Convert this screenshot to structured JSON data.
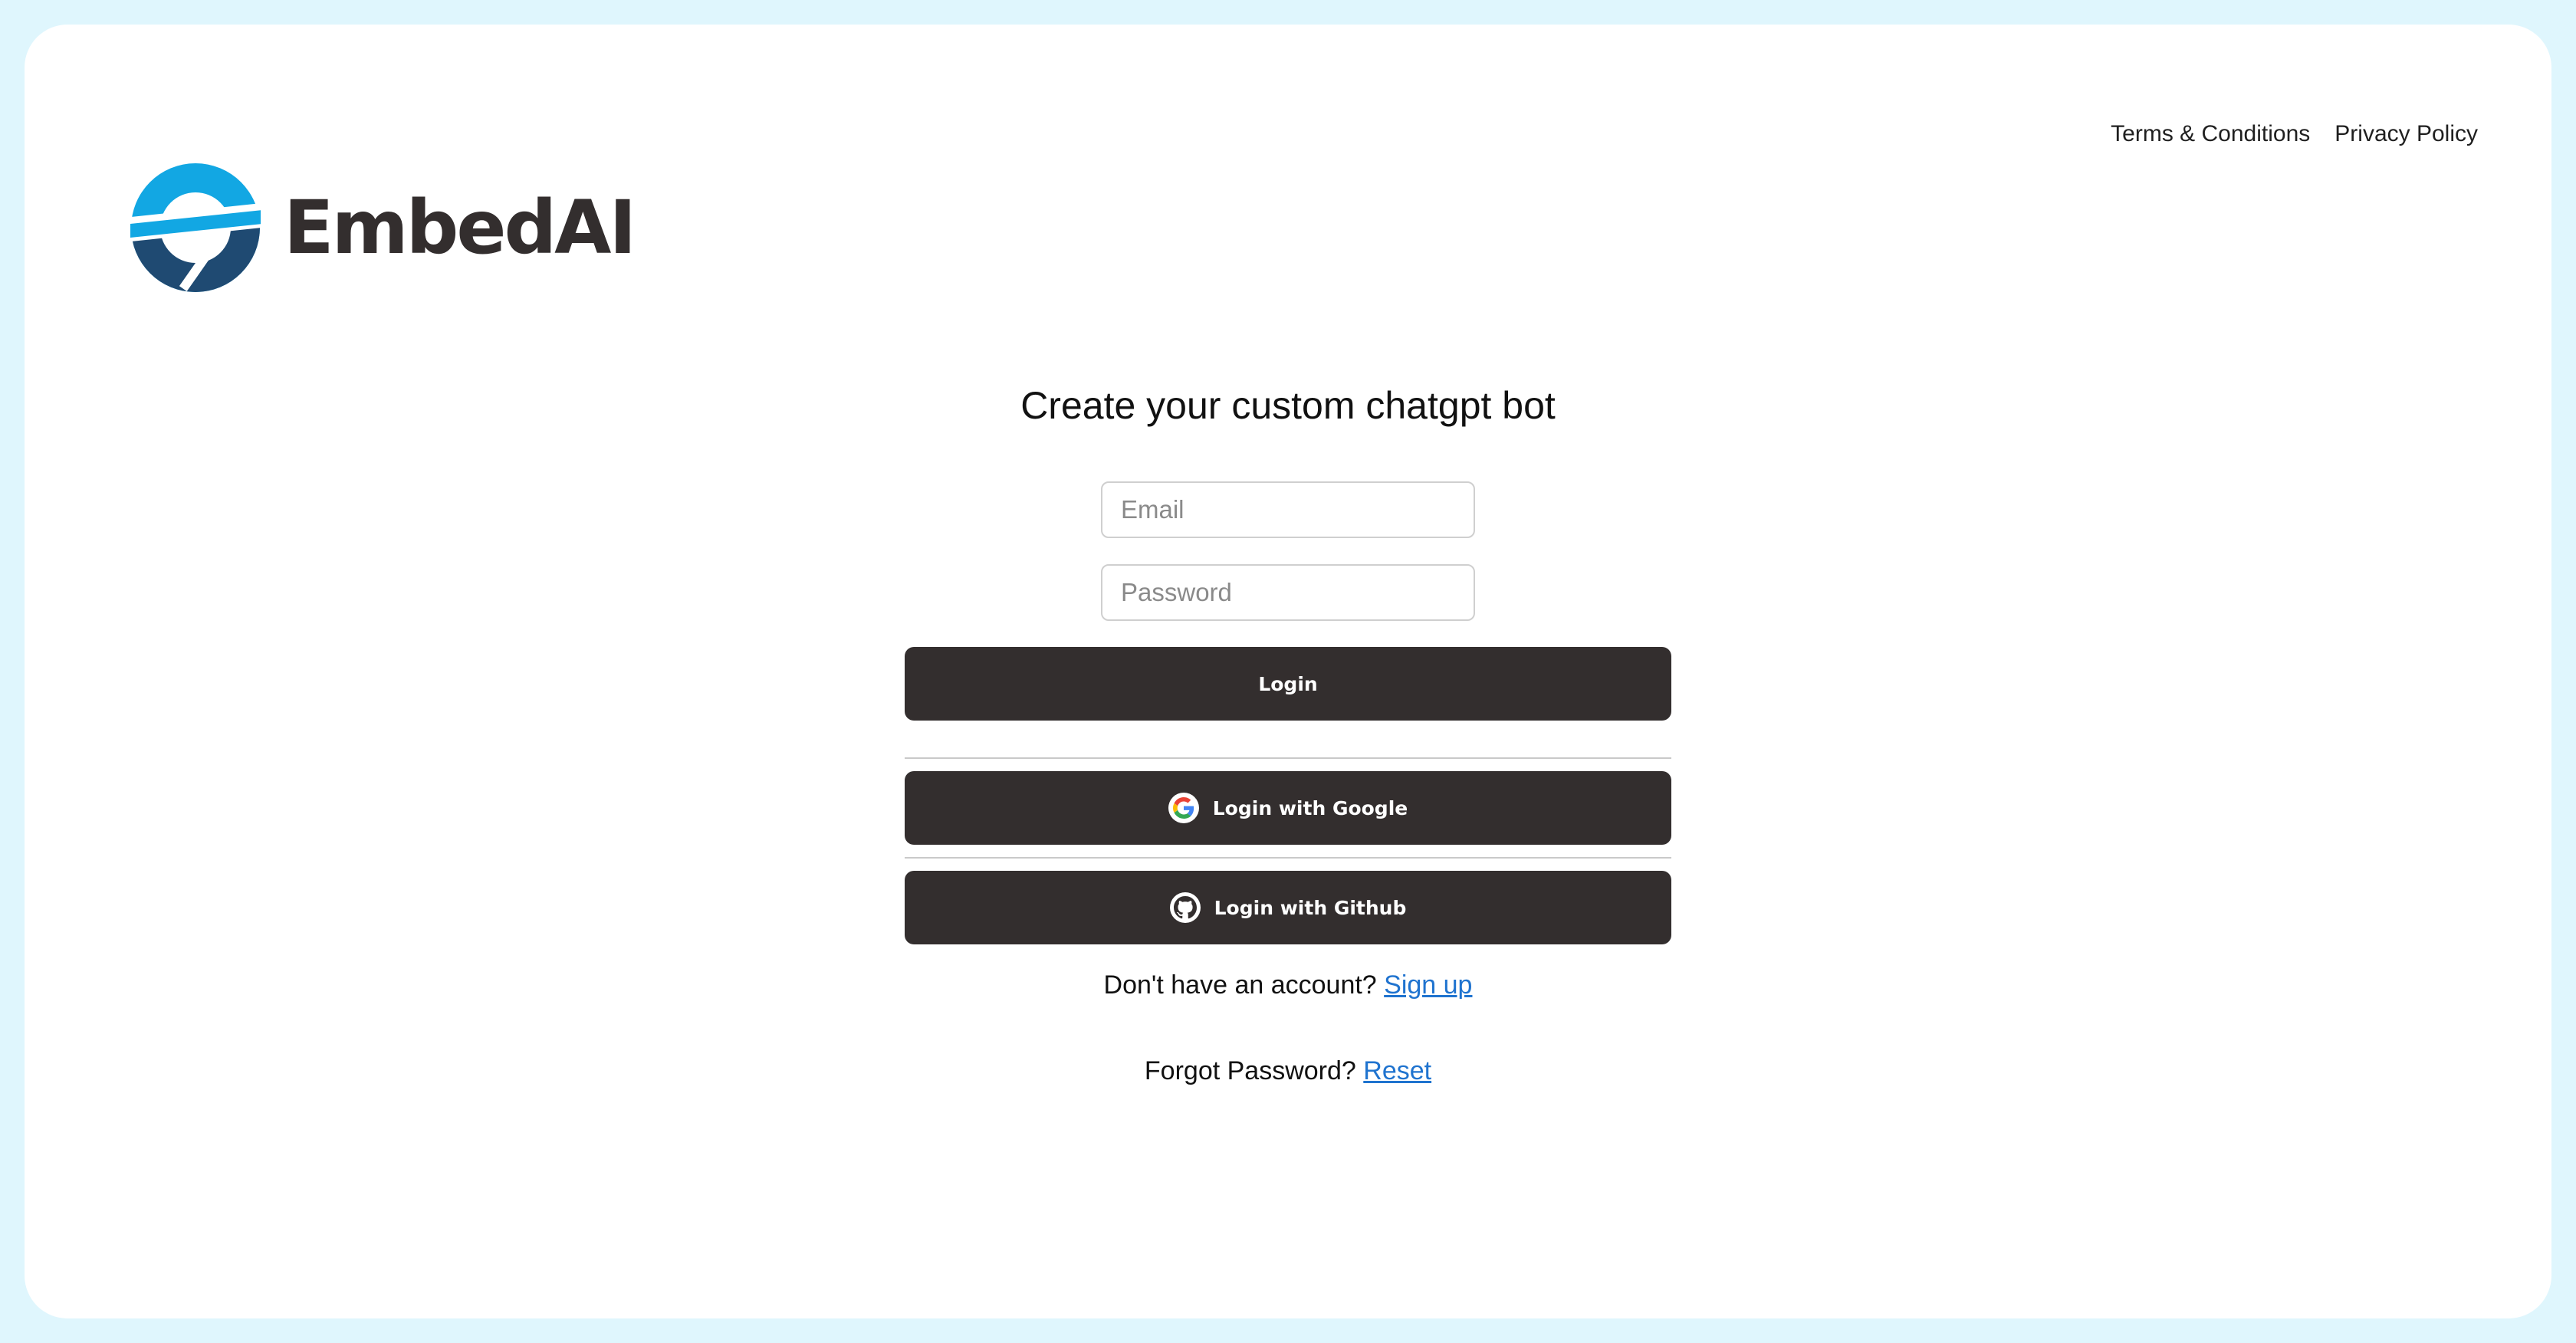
{
  "nav": {
    "terms_label": "Terms & Conditions",
    "privacy_label": "Privacy Policy"
  },
  "brand": {
    "name": "EmbedAI",
    "logo_icon": "embedai-logo-icon",
    "colors": {
      "logo_light": "#12a7e3",
      "logo_dark": "#1f4a72",
      "text": "#332e2e"
    }
  },
  "login_form": {
    "headline": "Create your custom chatgpt bot",
    "email_placeholder": "Email",
    "password_placeholder": "Password",
    "login_label": "Login",
    "google_label": "Login with Google",
    "github_label": "Login with Github",
    "google_icon": "google-icon",
    "github_icon": "github-icon",
    "button_color": "#332e2e"
  },
  "footer_links": {
    "signup_prompt": "Don't have an account?",
    "signup_link": "Sign up",
    "reset_prompt": "Forgot Password?",
    "reset_link": "Reset",
    "link_color": "#1f73cf"
  },
  "page": {
    "background_color": "#dff6fd"
  }
}
